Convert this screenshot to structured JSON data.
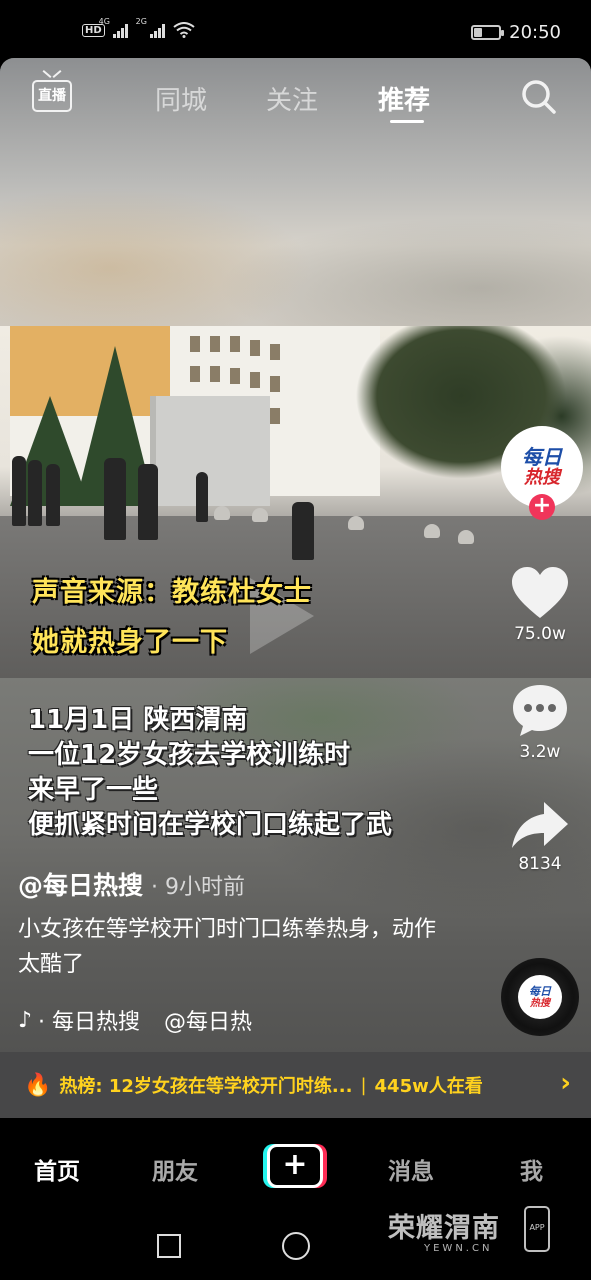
{
  "status_bar": {
    "hd": "HD",
    "sig1": "4G",
    "sig2": "2G",
    "time": "20:50"
  },
  "top_nav": {
    "live_label": "直播",
    "tabs": [
      {
        "label": "同城"
      },
      {
        "label": "关注"
      },
      {
        "label": "推荐"
      }
    ],
    "active_tab": "推荐"
  },
  "video": {
    "captions": [
      "声音来源：教练杜女士",
      "她就热身了一下"
    ],
    "subtitle_lines": [
      "11月1日 陕西渭南",
      "一位12岁女孩去学校训练时",
      "来早了一些",
      "便抓紧时间在学校门口练起了武"
    ],
    "author": "@每日热搜",
    "posted": "· 9小时前",
    "description": "小女孩在等学校开门时门口练拳热身，动作太酷了",
    "music_icon": "♪",
    "music_text": "· 每日热搜",
    "music_text2": "@每日热"
  },
  "rail": {
    "avatar_line1": "每日",
    "avatar_line2": "热搜",
    "likes": "75.0w",
    "comments": "3.2w",
    "shares": "8134"
  },
  "hot": {
    "label": "热榜: 12岁女孩在等学校开门时练...",
    "sep": "|",
    "count": "445w人在看",
    "arrow": "›"
  },
  "bottom_nav": {
    "home": "首页",
    "friends": "朋友",
    "plus": "+",
    "messages": "消息",
    "me": "我"
  },
  "watermark": {
    "title": "荣耀渭南",
    "url": "YEWN.CN",
    "app": "APP"
  },
  "colors": {
    "accent_pink": "#fe2c55",
    "accent_cyan": "#25f4ee",
    "hot_yellow": "#ffd21e",
    "caption_yellow": "#ffe45a"
  }
}
